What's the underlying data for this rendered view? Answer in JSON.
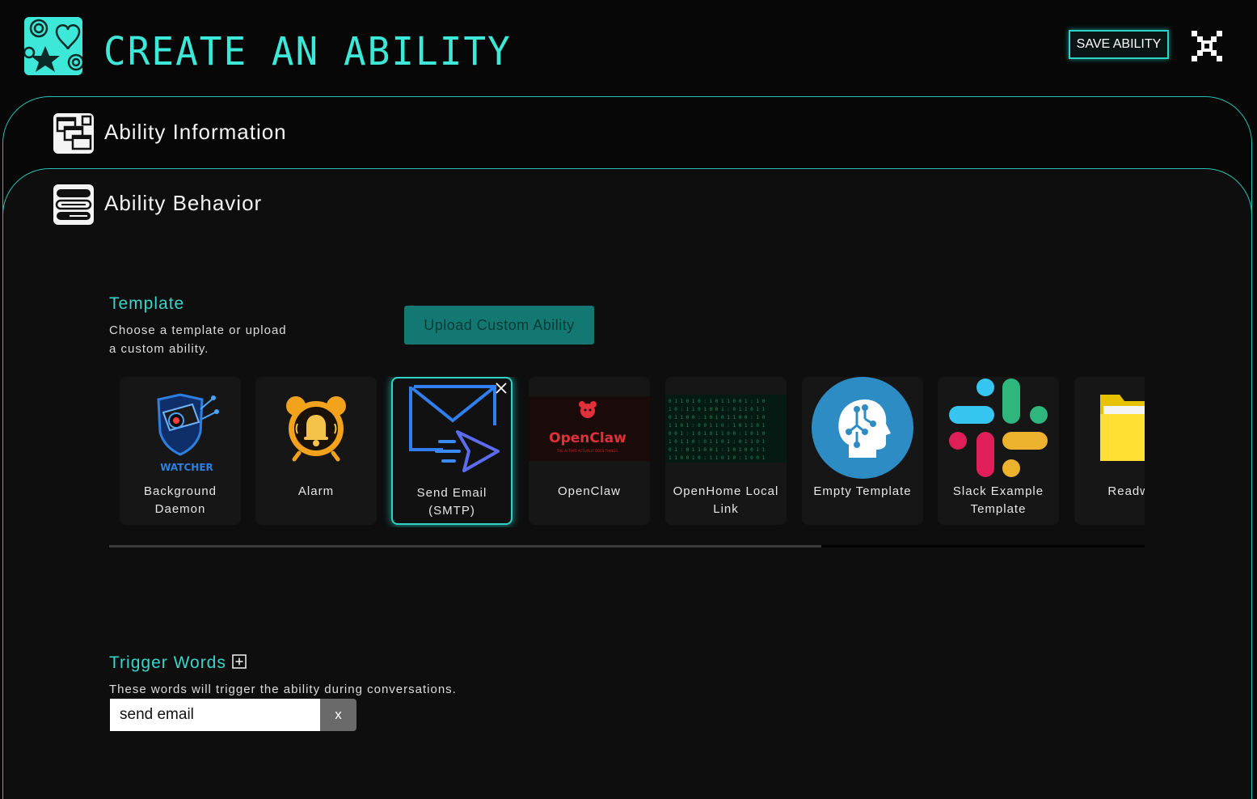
{
  "header": {
    "title": "CREATE AN ABILITY",
    "save_label": "SAVE ABILITY",
    "logo_icon": "stars-hearts-logo-icon",
    "close_icon": "pixel-x-close-icon",
    "accent_color": "#3ee8d8"
  },
  "sections": [
    {
      "title": "Ability Information",
      "icon": "windows-stack-icon"
    },
    {
      "title": "Ability Behavior",
      "icon": "speech-bubbles-icon"
    }
  ],
  "template": {
    "label": "Template",
    "help": "Choose a template or upload\na custom ability.",
    "upload_label": "Upload Custom Ability",
    "cards": [
      {
        "name": "Background\nDaemon",
        "thumb_text": "WATCHER",
        "icon": "security-camera-shield-icon",
        "selected": false
      },
      {
        "name": "Alarm",
        "icon": "alarm-clock-bell-icon",
        "selected": false
      },
      {
        "name": "Send Email\n(SMTP)",
        "icon": "email-send-icon",
        "selected": true
      },
      {
        "name": "OpenClaw",
        "thumb_text": "OpenClaw",
        "thumb_subtext": "THE AI THAT ACTUALLY DOES THINGS.",
        "icon": "openclaw-logo-icon",
        "selected": false
      },
      {
        "name": "OpenHome Local\nLink",
        "icon": "matrix-code-icon",
        "selected": false
      },
      {
        "name": "Empty Template",
        "icon": "head-circuit-icon",
        "selected": false
      },
      {
        "name": "Slack Example\nTemplate",
        "icon": "slack-logo-icon",
        "selected": false
      },
      {
        "name": "Readwrit",
        "icon": "folder-icon",
        "selected": false
      }
    ]
  },
  "trigger": {
    "label": "Trigger Words",
    "help": "These words will trigger the ability during conversations.",
    "value": "send email",
    "remove_label": "x"
  }
}
